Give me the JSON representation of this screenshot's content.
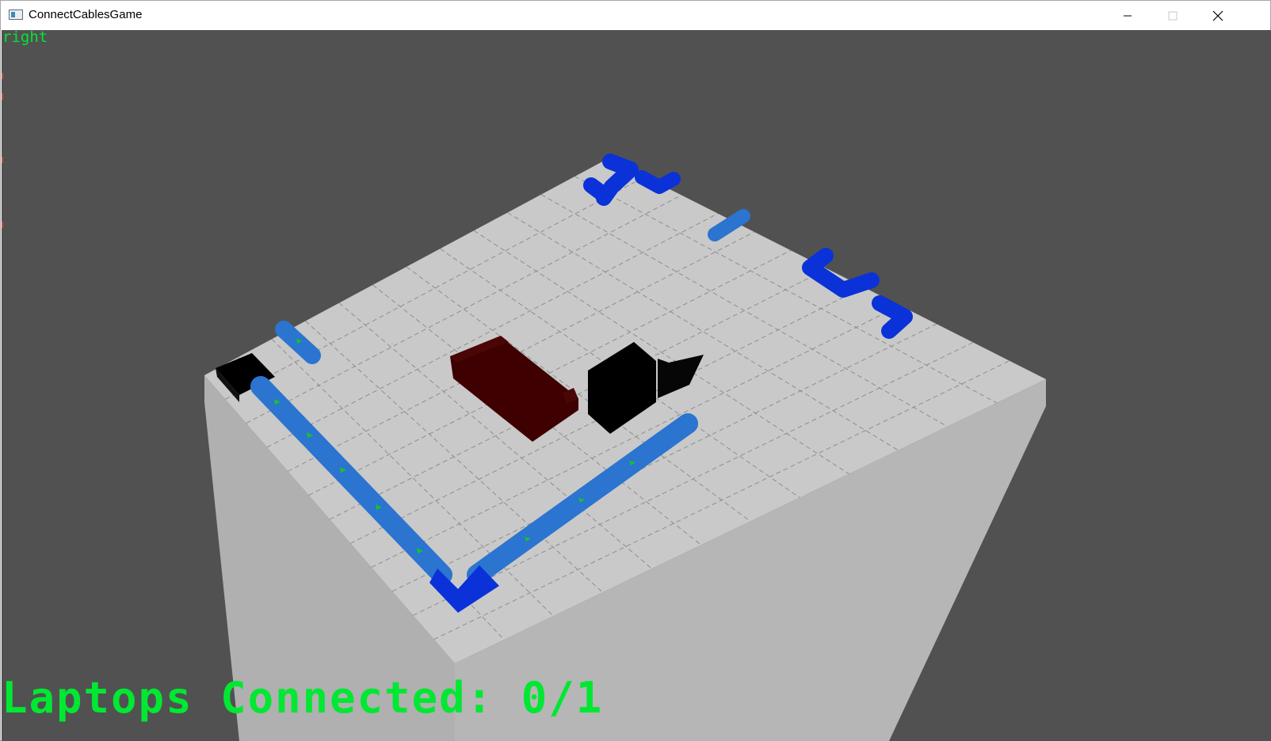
{
  "window": {
    "title": "ConnectCablesGame",
    "controls": [
      "minimize",
      "maximize",
      "close"
    ]
  },
  "hud": {
    "direction": "right",
    "status": "Laptops Connected: 0/1",
    "text_color": "#00e832"
  },
  "scene": {
    "background": "#515151",
    "board_color": "#c8c8c8",
    "grid_size": "12x12",
    "objects": [
      {
        "kind": "cable-straight",
        "color": "#2b74d0"
      },
      {
        "kind": "cable-straight-long",
        "color": "#2b74d0"
      },
      {
        "kind": "cable-straight-long",
        "color": "#2b74d0"
      },
      {
        "kind": "cable-corner",
        "color": "#0a32d8"
      },
      {
        "kind": "cable-corner",
        "color": "#0a32d8"
      },
      {
        "kind": "cable-corner",
        "color": "#0a32d8"
      },
      {
        "kind": "cable-corner",
        "color": "#0a32d8"
      },
      {
        "kind": "cable-straight",
        "color": "#2b74d0"
      },
      {
        "kind": "couch",
        "color": "#3e0000"
      },
      {
        "kind": "laptop",
        "color": "#000000"
      },
      {
        "kind": "chair",
        "color": "#000000"
      },
      {
        "kind": "power-source",
        "color": "#000000"
      }
    ]
  }
}
